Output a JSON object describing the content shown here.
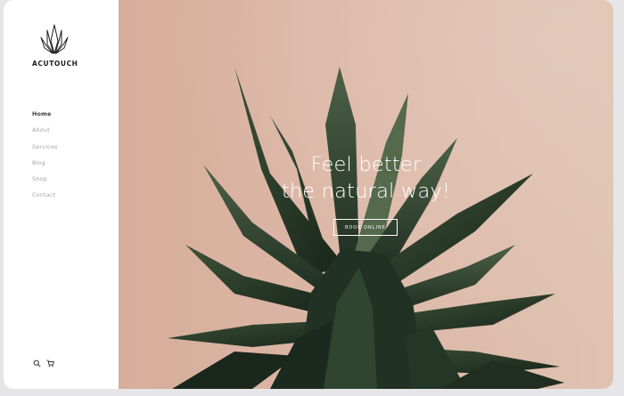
{
  "brand": {
    "name": "ACUTOUCH",
    "logo_icon": "lotus-leaves-icon"
  },
  "nav": {
    "items": [
      {
        "label": "Home",
        "active": true
      },
      {
        "label": "About",
        "active": false
      },
      {
        "label": "Services",
        "active": false
      },
      {
        "label": "Blog",
        "active": false
      },
      {
        "label": "Shop",
        "active": false
      },
      {
        "label": "Contact",
        "active": false
      }
    ]
  },
  "tools": {
    "search_icon": "search-icon",
    "cart_icon": "cart-icon"
  },
  "hero": {
    "headline_line1": "Feel better",
    "headline_line2": "the natural way!",
    "button_label": "BOOK ONLINE",
    "image": "agave-plant-photo"
  },
  "colors": {
    "hero_bg": "#dcb7a6",
    "plant_dark": "#2b3d2c",
    "plant_light": "#4b5f45",
    "text_dark": "#1e1e1e",
    "nav_muted": "#a4a4a4",
    "page_bg": "#e6e6e8"
  }
}
